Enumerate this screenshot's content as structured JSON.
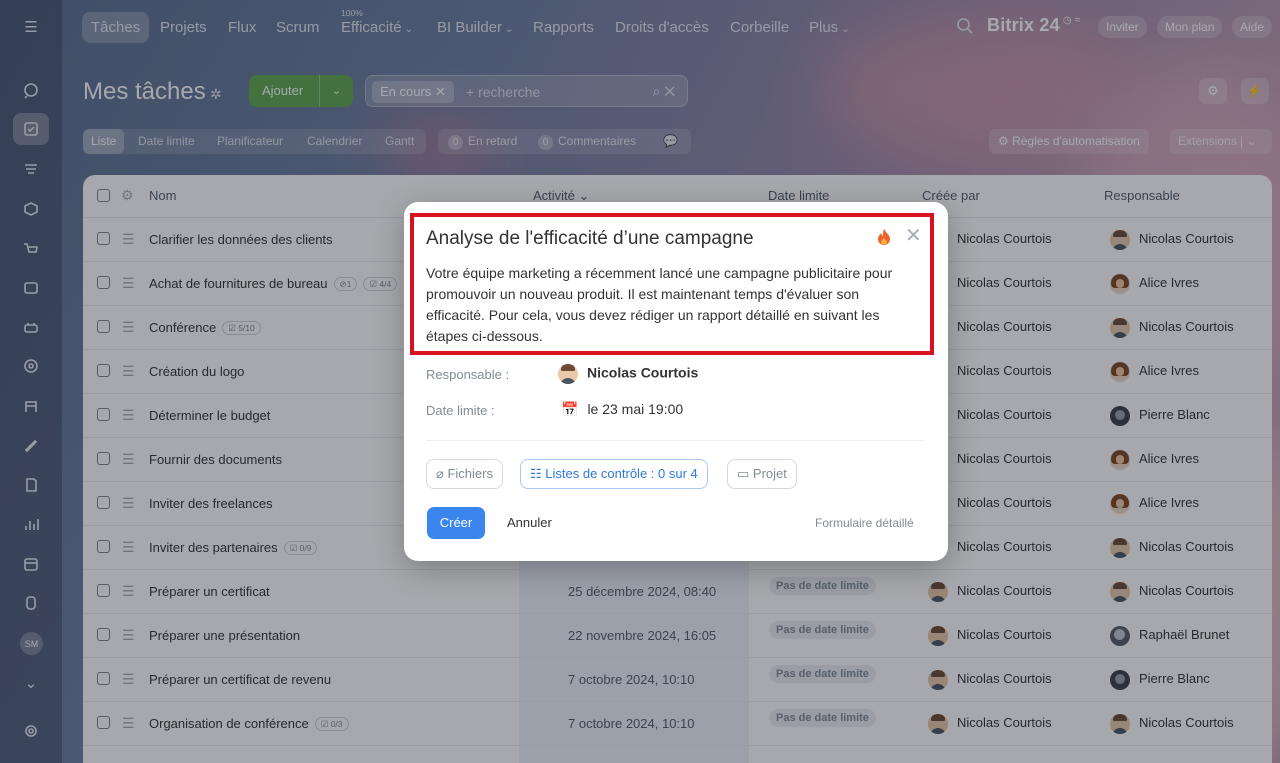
{
  "topbar": {
    "nav": [
      {
        "label": "Tâches",
        "active": true
      },
      {
        "label": "Projets"
      },
      {
        "label": "Flux"
      },
      {
        "label": "Scrum"
      },
      {
        "label": "Efficacité",
        "superscript": "100%",
        "chevron": true
      },
      {
        "label": "BI Builder",
        "chevron": true
      },
      {
        "label": "Rapports"
      },
      {
        "label": "Droits d'accès"
      },
      {
        "label": "Corbeille"
      },
      {
        "label": "Plus",
        "chevron": true
      }
    ],
    "brand": "Bitrix 24",
    "invite": "Inviter",
    "plan": "Mon plan",
    "help": "Aide"
  },
  "header": {
    "title": "Mes tâches",
    "add_button": "Ajouter",
    "filter_tag": "En cours",
    "search_placeholder": "+ recherche",
    "views": [
      "Liste",
      "Date limite",
      "Planificateur",
      "Calendrier",
      "Gantt"
    ],
    "counters": [
      {
        "count": "0",
        "label": "En retard"
      },
      {
        "count": "0",
        "label": "Commentaires"
      }
    ],
    "rules": "Règles d'automatisation",
    "extensions": "Extensions"
  },
  "grid": {
    "columns": [
      "Nom",
      "Activité",
      "Date limite",
      "Créée par",
      "Responsable"
    ],
    "rows": [
      {
        "name": "Clarifier les données des clients",
        "badge": "",
        "activity": "",
        "deadline": "",
        "creator": "Nicolas Courtois",
        "creator_av": "nc",
        "responsible": "Nicolas Courtois",
        "resp_av": "nc"
      },
      {
        "name": "Achat de fournitures de bureau",
        "badge": "⊘1",
        "badge2": "☑ 4/4",
        "activity": "",
        "deadline": "",
        "creator": "Nicolas Courtois",
        "creator_av": "nc",
        "responsible": "Alice Ivres",
        "resp_av": "ai"
      },
      {
        "name": "Conférence",
        "badge": "☑ 5/10",
        "activity": "",
        "deadline": "",
        "creator": "Nicolas Courtois",
        "creator_av": "nc",
        "responsible": "Nicolas Courtois",
        "resp_av": "nc"
      },
      {
        "name": "Création du logo",
        "badge": "",
        "activity": "",
        "deadline": "",
        "creator": "Nicolas Courtois",
        "creator_av": "nc",
        "responsible": "Alice Ivres",
        "resp_av": "ai"
      },
      {
        "name": "Déterminer le budget",
        "badge": "",
        "activity": "",
        "deadline": "",
        "creator": "Nicolas Courtois",
        "creator_av": "nc",
        "responsible": "Pierre Blanc",
        "resp_av": "pb"
      },
      {
        "name": "Fournir des documents",
        "badge": "",
        "activity": "",
        "deadline": "",
        "creator": "Nicolas Courtois",
        "creator_av": "nc",
        "responsible": "Alice Ivres",
        "resp_av": "ai"
      },
      {
        "name": "Inviter des freelances",
        "badge": "",
        "activity": "",
        "deadline": "",
        "creator": "Nicolas Courtois",
        "creator_av": "nc",
        "responsible": "Alice Ivres",
        "resp_av": "ai"
      },
      {
        "name": "Inviter des partenaires",
        "badge": "☑ 0/9",
        "activity": "",
        "deadline": "",
        "creator": "Nicolas Courtois",
        "creator_av": "nc",
        "responsible": "Nicolas Courtois",
        "resp_av": "nc"
      },
      {
        "name": "Préparer un certificat",
        "badge": "",
        "activity": "25 décembre 2024, 08:40",
        "deadline": "Pas de date limite",
        "creator": "Nicolas Courtois",
        "creator_av": "nc",
        "responsible": "Nicolas Courtois",
        "resp_av": "nc"
      },
      {
        "name": "Préparer une présentation",
        "badge": "",
        "activity": "22 novembre 2024, 16:05",
        "deadline": "Pas de date limite",
        "creator": "Nicolas Courtois",
        "creator_av": "nc",
        "responsible": "Raphaël Brunet",
        "resp_av": "rb"
      },
      {
        "name": "Préparer un certificat de revenu",
        "badge": "",
        "activity": "7 octobre 2024, 10:10",
        "deadline": "Pas de date limite",
        "creator": "Nicolas Courtois",
        "creator_av": "nc",
        "responsible": "Pierre Blanc",
        "resp_av": "pb"
      },
      {
        "name": "Organisation de conférence",
        "badge": "☑ 0/3",
        "activity": "7 octobre 2024, 10:10",
        "deadline": "Pas de date limite",
        "creator": "Nicolas Courtois",
        "creator_av": "nc",
        "responsible": "Nicolas Courtois",
        "resp_av": "nc"
      }
    ]
  },
  "modal": {
    "title": "Analyse de l'efficacité d’une campagne",
    "description": "Votre équipe marketing a récemment lancé une campagne publicitaire pour promouvoir un nouveau produit. Il est maintenant temps d'évaluer son efficacité. Pour cela, vous devez rédiger un rapport détaillé en suivant les étapes ci-dessous.",
    "responsible_label": "Responsable :",
    "responsible_value": "Nicolas Courtois",
    "deadline_label": "Date limite :",
    "deadline_value": "le 23 mai 19:00",
    "files": "Fichiers",
    "checklists": "Listes de contrôle : 0 sur 4",
    "project": "Projet",
    "create": "Créer",
    "cancel": "Annuler",
    "detailed_form": "Formulaire détaillé"
  },
  "sidebar": {
    "avatar_initials": "SM"
  },
  "colors": {
    "accent_blue": "#3a86ee",
    "add_green": "#5fa84c",
    "highlight_red": "#d6121e"
  }
}
